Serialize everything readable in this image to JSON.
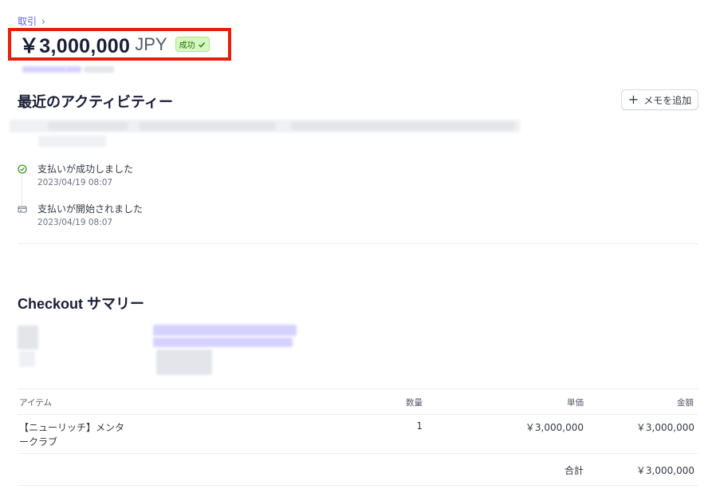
{
  "breadcrumb": {
    "label": "取引",
    "chevron": "›"
  },
  "payment": {
    "amount": "￥3,000,000",
    "currency": "JPY",
    "status": "成功"
  },
  "activity": {
    "title": "最近のアクティビティー",
    "add_memo_label": "メモを追加",
    "events": [
      {
        "title": "支払いが成功しました",
        "time": "2023/04/19 08:07",
        "icon": "check-circle-icon"
      },
      {
        "title": "支払いが開始されました",
        "time": "2023/04/19 08:07",
        "icon": "card-icon"
      }
    ]
  },
  "checkout": {
    "title": "Checkout サマリー",
    "columns": {
      "item": "アイテム",
      "qty": "数量",
      "unit_price": "単価",
      "amount": "金額"
    },
    "rows": [
      {
        "item_line1": "【ニューリッチ】メンタ",
        "item_line2": "ークラブ",
        "qty": "1",
        "unit_price": "￥3,000,000",
        "amount": "￥3,000,000"
      }
    ],
    "total_label": "合計",
    "total_value": "￥3,000,000"
  },
  "colors": {
    "link": "#625afa",
    "highlight_border": "#e81e0a",
    "success_bg": "#d7f7c2",
    "success_text": "#217005"
  }
}
